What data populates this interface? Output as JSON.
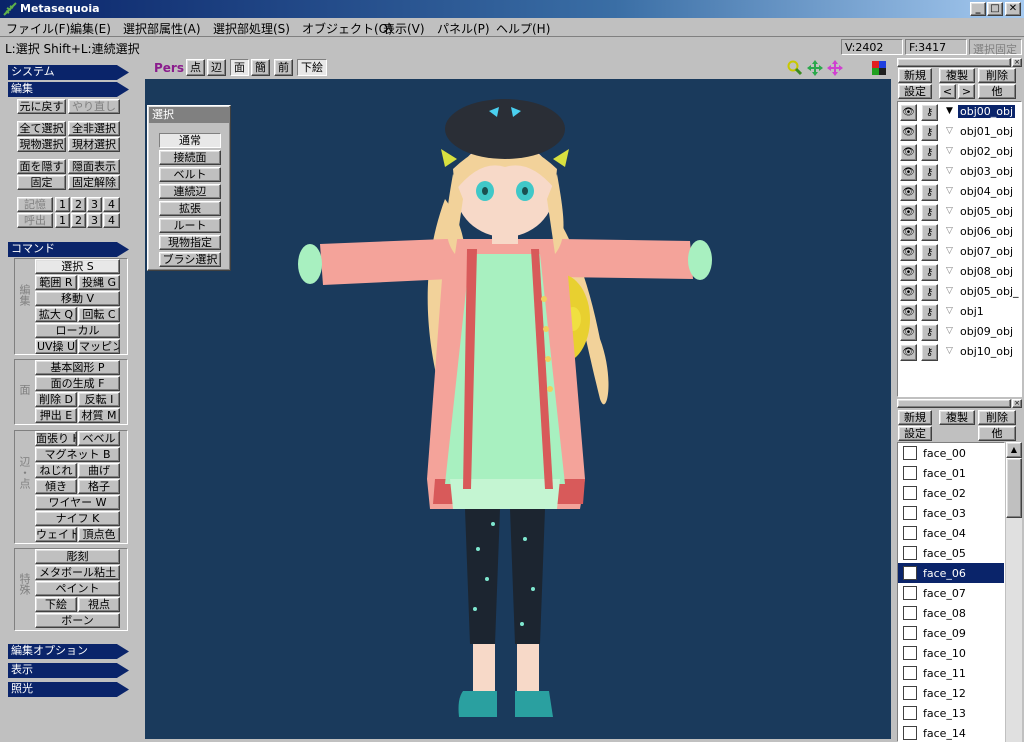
{
  "window": {
    "title": "Metasequoia",
    "min": "_",
    "max": "□",
    "close": "✕"
  },
  "menu": [
    "ファイル(F)",
    "編集(E)",
    "選択部属性(A)",
    "選択部処理(S)",
    "オブジェクト(O)",
    "表示(V)",
    "パネル(P)",
    "ヘルプ(H)"
  ],
  "status": {
    "hint": "L:選択  Shift+L:連続選択",
    "vertices": "V:2402",
    "faces": "F:3417",
    "lock": "選択固定"
  },
  "left": {
    "system": "システム",
    "edit": "編集",
    "undo": "元に戻す",
    "redo": "やり直し",
    "select_all": "全て選択",
    "deselect_all": "全非選択",
    "select_current": "現物選択",
    "select_material": "現材選択",
    "hide_faces": "面を隠す",
    "show_hidden": "隠面表示",
    "fix": "固定",
    "unfix": "固定解除",
    "memory": "記憶",
    "recall": "呼出",
    "slots": [
      "1",
      "2",
      "3",
      "4"
    ],
    "commands": "コマンド",
    "edit_group_label": "編集",
    "select": "選択 S",
    "range": "範囲 R",
    "lasso": "投縄 G",
    "move": "移動 V",
    "scale": "拡大 Q",
    "rotate": "回転 C",
    "local": "ローカル",
    "uv": "UV操 U",
    "mapping": "マッピング",
    "face_group_label": "面",
    "primitive": "基本図形 P",
    "face_gen": "面の生成 F",
    "delete": "削除 D",
    "flip": "反転 I",
    "extrude": "押出 E",
    "material": "材質 M",
    "edge_group_label": "辺・点",
    "face_stretch": "面張り H",
    "bevel": "ベベル",
    "magnet": "マグネット B",
    "twist": "ねじれ",
    "bend": "曲げ",
    "tilt": "傾き",
    "lattice": "格子",
    "wire": "ワイヤー W",
    "knife": "ナイフ K",
    "weight": "ウェイト",
    "vertex_color": "頂点色",
    "special_group_label": "特殊",
    "sculpt": "彫刻",
    "metaball": "メタボール粘土",
    "paint": "ペイント",
    "underlay": "下絵",
    "viewpoint": "視点",
    "bone": "ボーン",
    "edit_options": "編集オプション",
    "display": "表示",
    "lighting": "照光"
  },
  "viewport": {
    "mode": "Pers",
    "buttons": [
      "点",
      "辺",
      "面",
      "簡",
      "前"
    ],
    "underlay": "下絵"
  },
  "select_panel": {
    "title": "選択",
    "items": [
      "通常",
      "接続面",
      "ベルト",
      "連続辺",
      "拡張",
      "ルート",
      "現物指定",
      "ブラシ選択"
    ]
  },
  "objects": {
    "new": "新規",
    "copy": "複製",
    "delete": "削除",
    "settings": "設定",
    "prev": "<",
    "next": ">",
    "other": "他",
    "items": [
      "obj00_obj",
      "obj01_obj",
      "obj02_obj",
      "obj03_obj",
      "obj04_obj",
      "obj05_obj",
      "obj06_obj",
      "obj07_obj",
      "obj08_obj",
      "obj05_obj_",
      "obj1",
      "obj09_obj",
      "obj10_obj"
    ]
  },
  "materials": {
    "new": "新規",
    "copy": "複製",
    "delete": "削除",
    "settings": "設定",
    "other": "他",
    "items": [
      "face_00",
      "face_01",
      "face_02",
      "face_03",
      "face_04",
      "face_05",
      "face_06",
      "face_07",
      "face_08",
      "face_09",
      "face_10",
      "face_11",
      "face_12",
      "face_13",
      "face_14"
    ]
  },
  "colors": {
    "title_blue": "#0a246a",
    "viewport_bg": "#1a3a5c",
    "accent_purple": "#8a1c8c"
  }
}
